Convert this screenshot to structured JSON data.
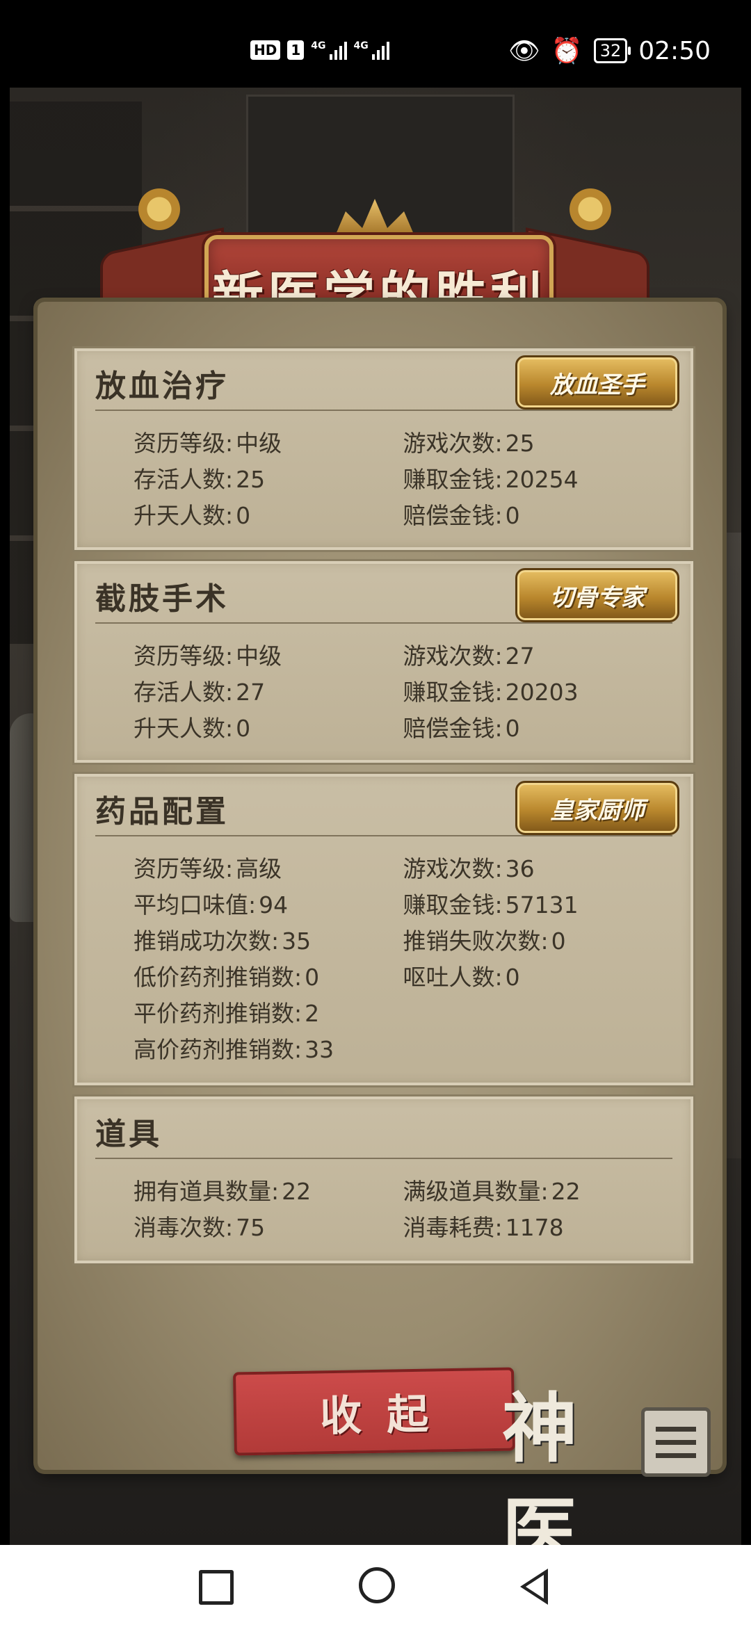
{
  "statusbar": {
    "hd": "HD",
    "sim": "1",
    "net1": "4G",
    "net2": "4G",
    "battery": "32",
    "time": "02:50"
  },
  "banner": {
    "title": "新医学的胜利"
  },
  "sections": [
    {
      "title": "放血治疗",
      "badge": "放血圣手",
      "rows": [
        [
          {
            "label": "资历等级",
            "value": "中级"
          },
          {
            "label": "游戏次数",
            "value": "25"
          }
        ],
        [
          {
            "label": "存活人数",
            "value": "25"
          },
          {
            "label": "赚取金钱",
            "value": "20254"
          }
        ],
        [
          {
            "label": "升天人数",
            "value": "0"
          },
          {
            "label": "赔偿金钱",
            "value": "0"
          }
        ]
      ]
    },
    {
      "title": "截肢手术",
      "badge": "切骨专家",
      "rows": [
        [
          {
            "label": "资历等级",
            "value": "中级"
          },
          {
            "label": "游戏次数",
            "value": "27"
          }
        ],
        [
          {
            "label": "存活人数",
            "value": "27"
          },
          {
            "label": "赚取金钱",
            "value": "20203"
          }
        ],
        [
          {
            "label": "升天人数",
            "value": "0"
          },
          {
            "label": "赔偿金钱",
            "value": "0"
          }
        ]
      ]
    },
    {
      "title": "药品配置",
      "badge": "皇家厨师",
      "rows": [
        [
          {
            "label": "资历等级",
            "value": "高级"
          },
          {
            "label": "游戏次数",
            "value": "36"
          }
        ],
        [
          {
            "label": "平均口味值",
            "value": "94"
          },
          {
            "label": "赚取金钱",
            "value": "57131"
          }
        ],
        [
          {
            "label": "推销成功次数",
            "value": "35"
          },
          {
            "label": "推销失败次数",
            "value": "0"
          }
        ],
        [
          {
            "label": "低价药剂推销数",
            "value": "0"
          },
          {
            "label": "呕吐人数",
            "value": "0"
          }
        ],
        [
          {
            "label": "平价药剂推销数",
            "value": "2"
          }
        ],
        [
          {
            "label": "高价药剂推销数",
            "value": "33"
          }
        ]
      ]
    },
    {
      "title": "道具",
      "rows": [
        [
          {
            "label": "拥有道具数量",
            "value": "22"
          },
          {
            "label": "满级道具数量",
            "value": "22"
          }
        ],
        [
          {
            "label": "消毒次数",
            "value": "75"
          },
          {
            "label": "消毒耗费",
            "value": "1178"
          }
        ]
      ]
    }
  ],
  "footer": {
    "collapse_label": "收起",
    "logo_text": "神医"
  }
}
